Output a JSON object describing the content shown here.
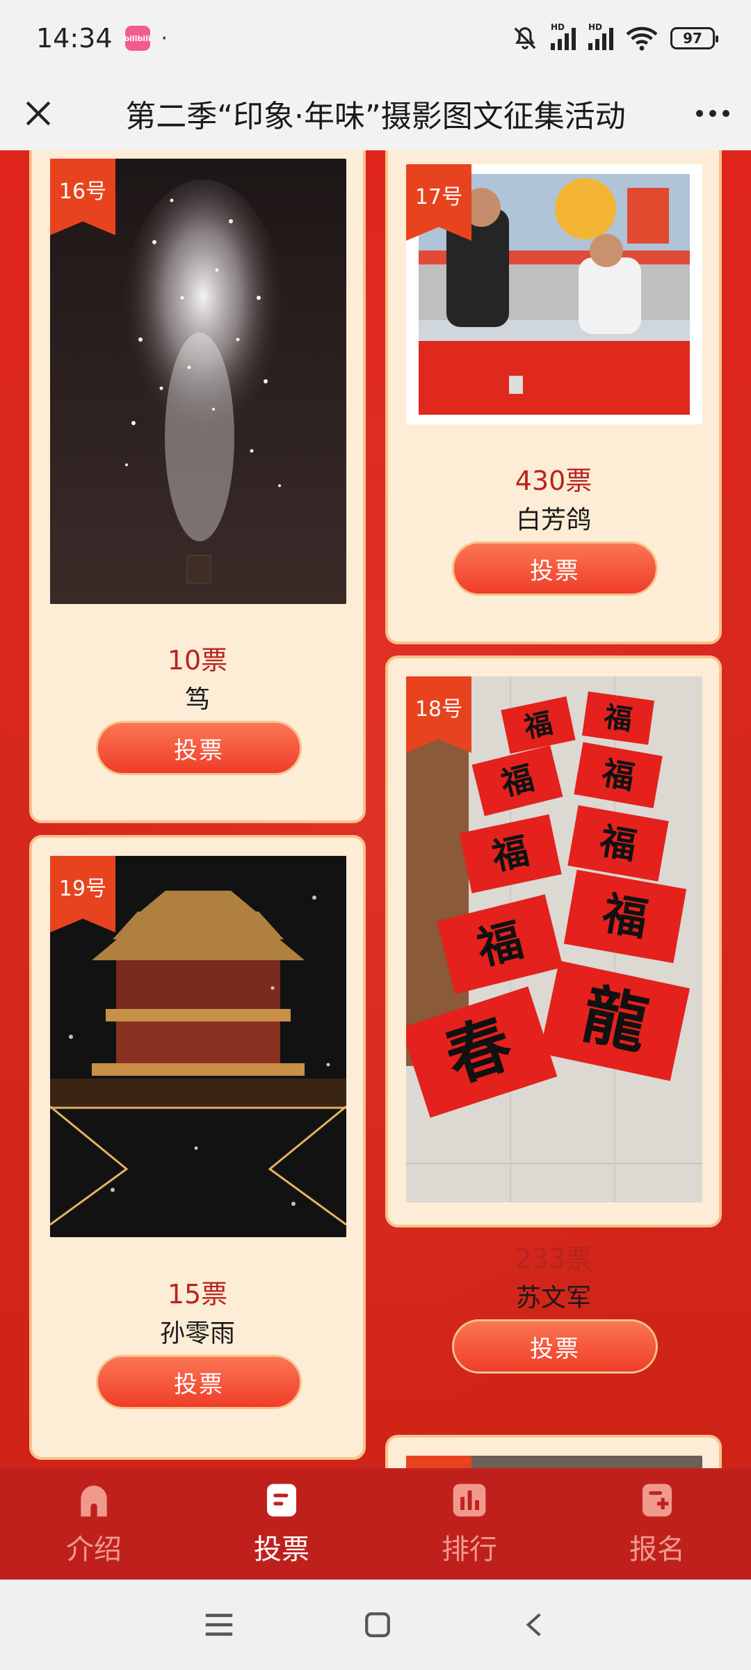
{
  "status_bar": {
    "time": "14:34",
    "app_badge": "bilibili",
    "dot": "·",
    "battery": "97",
    "hd1": "HD",
    "hd2": "HD"
  },
  "header": {
    "title": "第二季“印象·年味”摄影图文征集活动",
    "close_icon": "close-icon",
    "more_icon": "more-icon"
  },
  "entries": [
    {
      "number": "16号",
      "votes": "10票",
      "name": "笃",
      "button": "投票"
    },
    {
      "number": "17号",
      "votes": "430票",
      "name": "白芳鸽",
      "button": "投票"
    },
    {
      "number": "18号",
      "votes": "233票",
      "name": "苏文军",
      "button": "投票"
    },
    {
      "number": "19号",
      "votes": "15票",
      "name": "孙零雨",
      "button": "投票"
    }
  ],
  "couplets": [
    "福",
    "福",
    "福",
    "福",
    "福",
    "福",
    "福",
    "福",
    "春",
    "龍"
  ],
  "bottom_nav": {
    "items": [
      {
        "label": "介绍",
        "icon": "home-icon",
        "active": false
      },
      {
        "label": "投票",
        "icon": "vote-icon",
        "active": true
      },
      {
        "label": "排行",
        "icon": "ranking-icon",
        "active": false
      },
      {
        "label": "报名",
        "icon": "signup-icon",
        "active": false
      }
    ]
  },
  "colors": {
    "accent": "#e0261c",
    "nav_bg": "#c0201c",
    "card_bg": "#fdecd6",
    "button": "#ef3d2a"
  }
}
